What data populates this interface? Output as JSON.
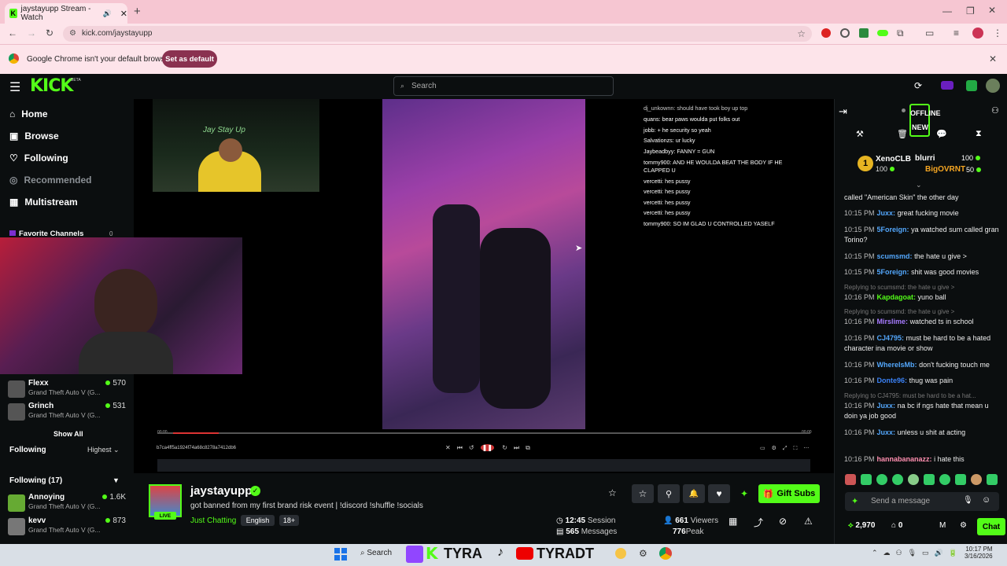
{
  "browser": {
    "tab_title": "jaystayupp Stream - Watch",
    "url": "kick.com/jaystayupp",
    "notice_text": "Google Chrome isn't your default browser",
    "set_default_label": "Set as default"
  },
  "header": {
    "logo": "KICK",
    "beta": "BETA",
    "search_placeholder": "Search"
  },
  "sidebar": {
    "nav": [
      {
        "label": "Home",
        "icon": "home-icon"
      },
      {
        "label": "Browse",
        "icon": "browse-icon"
      },
      {
        "label": "Following",
        "icon": "heart-icon"
      },
      {
        "label": "Recommended",
        "icon": "recommended-icon"
      },
      {
        "label": "Multistream",
        "icon": "multistream-icon"
      }
    ],
    "favorite_channels_label": "Favorite Channels",
    "favorite_count": "0",
    "recommended_channels": [
      {
        "name": "Flexx",
        "game": "Grand Theft Auto V (G...",
        "viewers": "570"
      },
      {
        "name": "Grinch",
        "game": "Grand Theft Auto V (G...",
        "viewers": "531"
      }
    ],
    "show_all": "Show All",
    "following_label": "Following",
    "sort_label": "Highest",
    "following_count_label": "Following (17)",
    "following_channels": [
      {
        "name": "Annoying",
        "game": "Grand Theft Auto V (G...",
        "viewers": "1.6K"
      },
      {
        "name": "kevv",
        "game": "Grand Theft Auto V (G...",
        "viewers": "873"
      }
    ]
  },
  "video": {
    "overlay_cam_label": "Jay Stay Up",
    "file_label": "b7ca4ff5a1924f74a68c8278a7412db6",
    "start_time": "00:00",
    "end_time": "00:00",
    "embedded_chat": [
      "dj_unkownn: should have took boy up top",
      "quans: bear paws woulda put folks out",
      "jobb: + he security so yeah",
      "Salvationzs: ur lucky",
      "Jaybeadbyy: FANNY = GUN",
      "tommy900: AND HE WOULDA BEAT THE BODY IF HE",
      "CLAPPED U",
      "vercetti: hes pussy",
      "vercetti: hes pussy",
      "vercetti: hes pussy",
      "vercetti: hes pussy",
      "tommy900: SO IM GLAD U CONTROLLED YASELF"
    ]
  },
  "stream": {
    "channel": "jaystayupp",
    "title": "got banned from my first brand risk event  | !discord !shuffle !socials",
    "category": "Just Chatting",
    "tags": [
      "English",
      "18+"
    ],
    "live_badge": "LIVE",
    "session": "12:45",
    "session_label": "Session",
    "messages": "565",
    "messages_label": "Messages",
    "viewers": "661",
    "viewers_label": "Viewers",
    "peak": "776",
    "peak_label": "Peak",
    "gift_subs_label": "Gift Subs"
  },
  "chat": {
    "offline_label": "OFFLINE",
    "new_label": "NEW",
    "leaderboard": [
      {
        "rank": "1",
        "name": "XenoCLB",
        "points": "100"
      },
      {
        "name": "blurri",
        "points": "100"
      },
      {
        "name": "BigOVRNT",
        "points": "50"
      }
    ],
    "messages": [
      {
        "time": "",
        "user": "",
        "text": "called \"American Skin\" the other day"
      },
      {
        "time": "10:15 PM",
        "user": "Juxx:",
        "text": "great fucking movie"
      },
      {
        "time": "10:15 PM",
        "user": "5Foreign:",
        "text": "ya watched sum called gran Torino?"
      },
      {
        "time": "10:15 PM",
        "user": "scumsmd:",
        "text": "the hate u give >"
      },
      {
        "time": "10:15 PM",
        "user": "5Foreign:",
        "text": "shit was good movies"
      },
      {
        "time": "10:16 PM",
        "user": "Kapdagoat:",
        "text": "yuno ball"
      },
      {
        "time": "10:16 PM",
        "user": "Mirslime:",
        "text": "watched ts in school"
      },
      {
        "time": "10:16 PM",
        "user": "CJ4795:",
        "text": "must be hard to be a hated character ina movie or show"
      },
      {
        "time": "10:16 PM",
        "user": "WhereIsMb:",
        "text": "don't fucking touch me"
      },
      {
        "time": "10:16 PM",
        "user": "Donte96:",
        "text": "thug was pain"
      },
      {
        "time": "10:16 PM",
        "user": "Juxx:",
        "text": "na bc if ngs hate that mean u doin ya job good"
      },
      {
        "time": "10:16 PM",
        "user": "Juxx:",
        "text": "unless u shit at acting"
      },
      {
        "time": "10:16 PM",
        "user": "hannabananazz:",
        "text": "i hate this"
      }
    ],
    "reply_1": "Replying to scumsmd: the hate u give >",
    "reply_2": "Replying to scumsmd: the hate u give >",
    "reply_3": "Replying to CJ4795: must be hard to be a hat...",
    "input_placeholder": "Send a message",
    "points": "2,970",
    "count": "0",
    "chat_button": "Chat"
  },
  "taskbar": {
    "search": "Search",
    "time": "10:17 PM",
    "date": "3/16/2026",
    "pinned_text_1": "TYRA",
    "pinned_text_2": "TYRADT"
  },
  "colors": {
    "kick_green": "#53fc18",
    "tab_pink": "#f6c6d2",
    "set_default": "#8a3150"
  }
}
